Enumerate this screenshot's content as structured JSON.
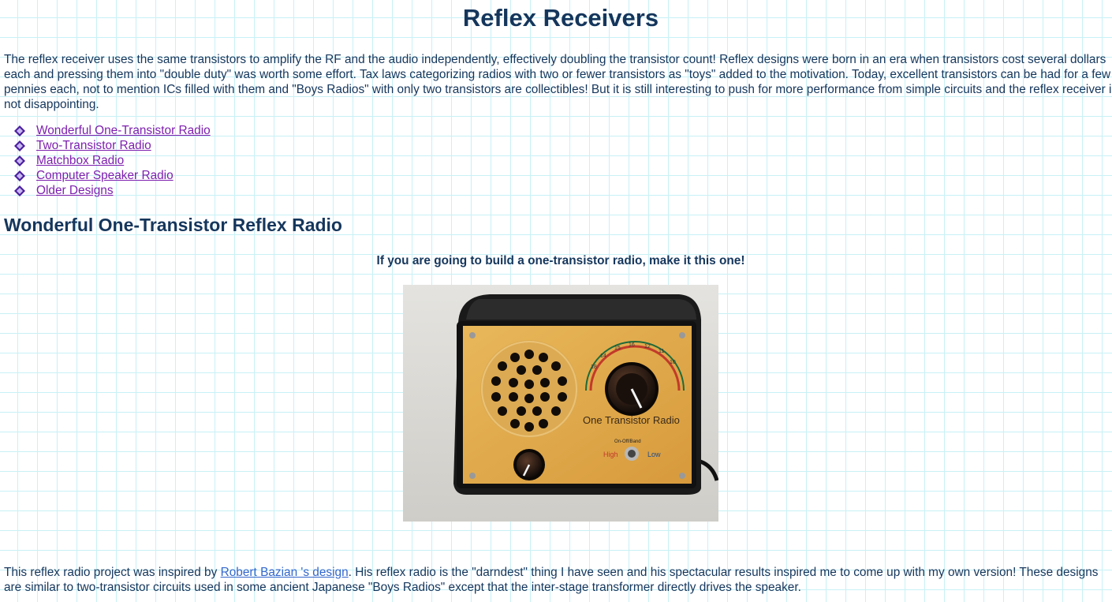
{
  "page": {
    "title": "Reflex Receivers",
    "intro": "The reflex receiver uses the same transistors to amplify the RF and the audio independently, effectively doubling the transistor count!  Reflex designs were born in an era when transistors cost several dollars each and pressing them into \"double duty\" was worth some effort. Tax laws categorizing radios with two or fewer transistors as \"toys\" added to the motivation. Today, excellent transistors can be had for a few pennies each, not to mention ICs filled with them and \"Boys Radios\" with only two transistors are collectibles! But it is still interesting to push for more performance from simple circuits and the reflex receiver is not disappointing."
  },
  "nav": {
    "items": [
      {
        "label": "Wonderful One-Transistor Radio"
      },
      {
        "label": "Two-Transistor Radio"
      },
      {
        "label": "Matchbox Radio"
      },
      {
        "label": "Computer Speaker Radio"
      },
      {
        "label": "Older Designs"
      }
    ],
    "bullet_icon": "diamond-bullet-icon",
    "link_color": "#7d1fae"
  },
  "section": {
    "heading": "Wonderful One-Transistor Reflex Radio",
    "tagline": "If you are going to build a one-transistor radio, make it this one!",
    "photo": {
      "panel_label": "One Transistor Radio",
      "switch_label": "On-Off/Band",
      "high_label": "High",
      "low_label": "Low",
      "dial_numbers": [
        "14",
        "15",
        "16",
        "12",
        "11",
        "10",
        "18"
      ]
    }
  },
  "outro": {
    "text_before": "This reflex radio project was inspired by ",
    "link": "Robert Bazian 's design",
    "text_after": ". His reflex radio is the \"darndest\" thing I have seen and his spectacular results inspired me to come up with my own version! These designs are  similar to two-transistor circuits used in some ancient Japanese \"Boys Radios\" except that the inter-stage transformer directly drives the speaker."
  },
  "colors": {
    "text": "#15365c",
    "grid": "#c8f1f6",
    "link": "#3366cc",
    "visited_link": "#7d1fae"
  }
}
